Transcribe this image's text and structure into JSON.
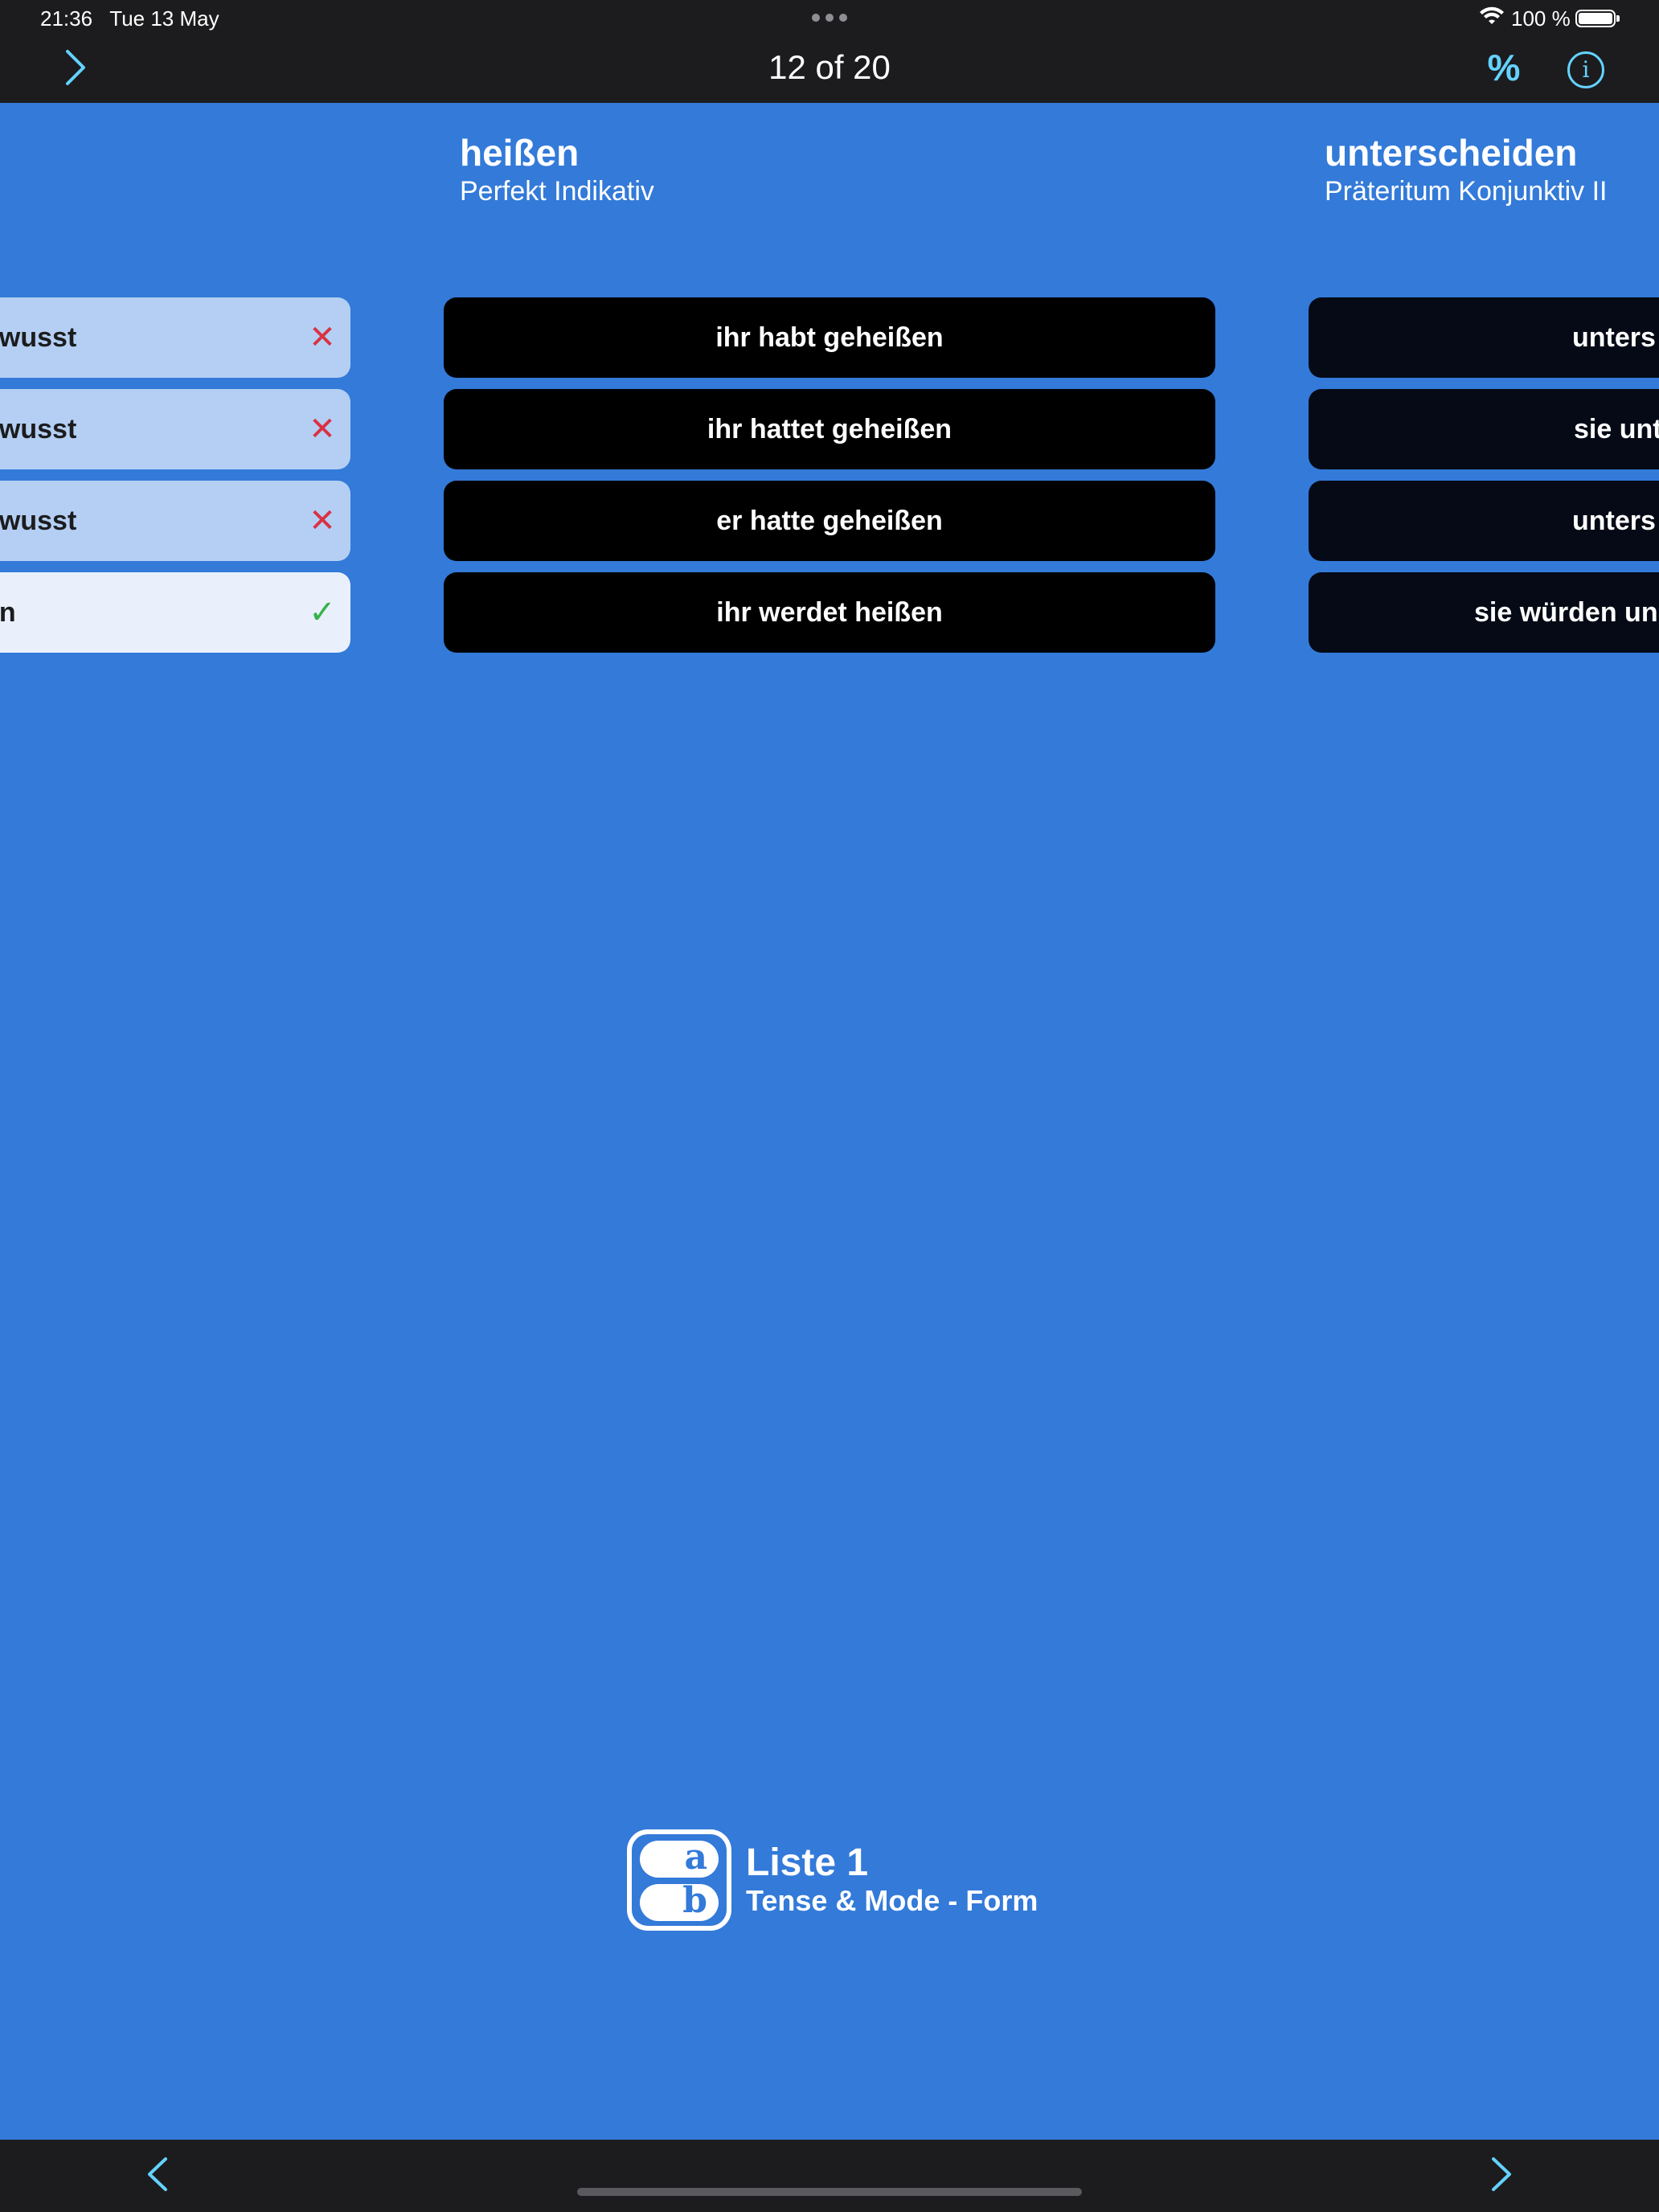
{
  "status_bar": {
    "time": "21:36",
    "date": "Tue 13 May",
    "battery": "100 %"
  },
  "nav": {
    "title": "12 of 20",
    "percent_label": "%",
    "info_label": "i"
  },
  "cards": {
    "left": {
      "answers": [
        {
          "text": "ewusst",
          "status": "wrong"
        },
        {
          "text": "ewusst",
          "status": "wrong"
        },
        {
          "text": "ewusst",
          "status": "wrong"
        },
        {
          "text": "en",
          "status": "correct"
        }
      ],
      "wrong_mark": "✕",
      "correct_mark": "✓"
    },
    "current": {
      "verb": "heißen",
      "tense": "Perfekt Indikativ",
      "answers": [
        "ihr habt geheißen",
        "ihr hattet geheißen",
        "er hatte geheißen",
        "ihr werdet heißen"
      ]
    },
    "right": {
      "verb": "unterscheiden",
      "tense": "Präteritum Konjunktiv II",
      "answers": [
        "unters",
        "sie unt",
        "unters",
        "sie würden un"
      ]
    }
  },
  "list": {
    "title": "Liste 1",
    "subtitle": "Tense & Mode - Form",
    "logo_letters": [
      "a",
      "b"
    ]
  },
  "colors": {
    "background": "#337ad9",
    "bar": "#1c1c1e",
    "accent": "#64d2ff",
    "wrong": "#d93244",
    "correct": "#34b24a"
  },
  "icons": {
    "nav_forward": "chevron-right-icon",
    "percent": "percent-icon",
    "info": "info-circle-icon",
    "toolbar_back": "chevron-left-icon",
    "toolbar_forward": "chevron-right-icon"
  }
}
